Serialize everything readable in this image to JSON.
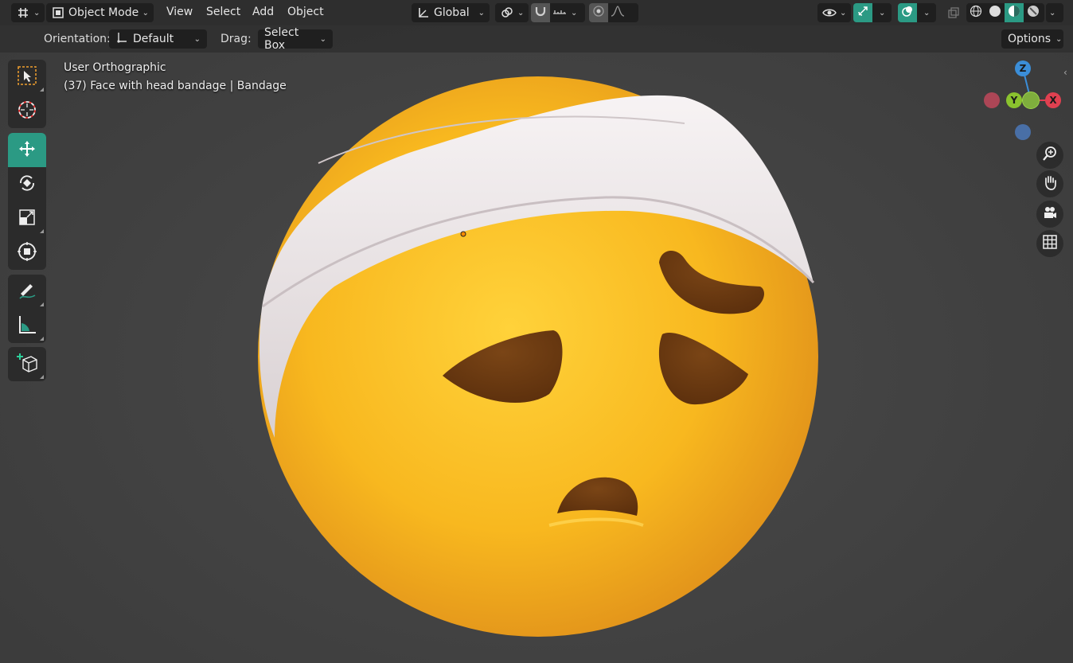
{
  "header": {
    "mode_label": "Object Mode",
    "menus": [
      "View",
      "Select",
      "Add",
      "Object"
    ],
    "transform_orientation": "Global",
    "options_label": "Options"
  },
  "tool_settings": {
    "orientation_label": "Orientation:",
    "orientation_value": "Default",
    "drag_label": "Drag:",
    "drag_value": "Select Box"
  },
  "viewport": {
    "view_name": "User Orthographic",
    "object_info": "(37) Face with head bandage | Bandage"
  },
  "gizmo": {
    "axes": [
      "Z",
      "Y",
      "X"
    ]
  },
  "toolbar": {
    "tools": [
      "select-box",
      "cursor",
      "move",
      "rotate",
      "scale",
      "transform",
      "annotate",
      "measure",
      "add-cube"
    ],
    "active_tool": "move"
  },
  "colors": {
    "accent": "#2b9a84",
    "face": "#f5b21c",
    "bandage": "#e9e3e4",
    "feature": "#6b3a12"
  }
}
